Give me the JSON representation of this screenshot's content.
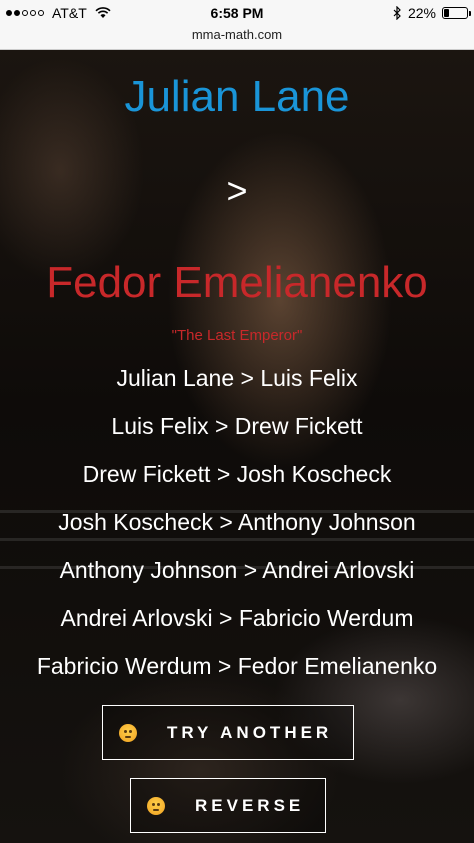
{
  "status_bar": {
    "carrier": "AT&T",
    "time": "6:58 PM",
    "battery": "22%",
    "battery_level": 0.22,
    "signal_dots_filled": 2,
    "signal_dots_total": 5
  },
  "url_bar": {
    "url": "mma-math.com"
  },
  "hero": {
    "fighter_a": "Julian Lane",
    "separator": ">",
    "fighter_b": "Fedor Emelianenko",
    "nickname": "\"The Last Emperor\"",
    "colors": {
      "fighter_a": "#1a95d8",
      "fighter_b": "#c8282a"
    }
  },
  "chain": [
    "Julian Lane > Luis Felix",
    "Luis Felix > Drew Fickett",
    "Drew Fickett > Josh Koscheck",
    "Josh Koscheck > Anthony Johnson",
    "Anthony Johnson > Andrei Arlovski",
    "Andrei Arlovski > Fabricio Werdum",
    "Fabricio Werdum > Fedor Emelianenko"
  ],
  "buttons": {
    "try_another": {
      "label": "TRY ANOTHER",
      "icon": "face-emoji-icon"
    },
    "reverse": {
      "label": "REVERSE",
      "icon": "face-emoji-icon"
    }
  }
}
